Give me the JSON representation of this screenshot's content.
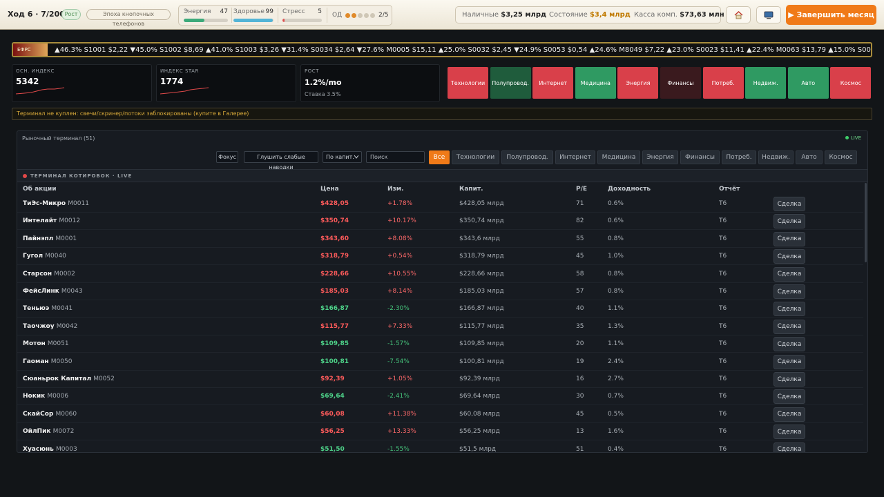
{
  "header": {
    "turn": "Ход 6 · 7/2006",
    "growth_pill": "Рост",
    "era_pill": "Эпоха кнопочных телефонов",
    "energy_label": "Энергия",
    "energy_value": "47",
    "energy_level": 0.47,
    "health_label": "Здоровье",
    "health_value": "99",
    "health_level": 0.99,
    "stress_label": "Стресс",
    "stress_value": "5",
    "stress_level": 0.05,
    "od_label": "ОД",
    "od_value": "2/5",
    "cash_label": "Наличные",
    "cash_value": "$3,25 млрд",
    "wealth_label": "Состояние",
    "wealth_value": "$3,4 млрд",
    "company_cash_label": "Касса комп.",
    "company_cash_value": "$73,63 млн",
    "home_icon": "home-icon",
    "computer_icon": "computer-icon",
    "end_month": "▶ Завершить месяц"
  },
  "ticker": {
    "tag": "ЕФРС",
    "text": "▲46.3%  S1001 $2,22 ▼45.0%  S1002 $8,69 ▲41.0%  S1003 $3,26 ▼31.4%  S0034 $2,64 ▼27.6%  M0005 $15,11 ▲25.0%  S0032 $2,45 ▼24.9%  S0053 $0,54 ▲24.6%  M8049 $7,22 ▲23.0%  S0023 $11,41 ▲22.4%  M0063 $13,79 ▲15.0%  S0033 $1,22 ▼15.0%"
  },
  "cards": {
    "main_index_label": "ОСН. ИНДЕКС",
    "main_index_value": "5342",
    "star_index_label": "ИНДЕКС STAR",
    "star_index_value": "1774",
    "growth_label": "РОСТ",
    "growth_value": "1.2%/mo",
    "rate": "Ставка 3.5%"
  },
  "sectors": [
    {
      "label": "Технологии",
      "color": "#d9404a"
    },
    {
      "label": "Полупровод.",
      "color": "#1f5c3c"
    },
    {
      "label": "Интернет",
      "color": "#d9404a"
    },
    {
      "label": "Медицина",
      "color": "#2f9a62"
    },
    {
      "label": "Энергия",
      "color": "#d9404a"
    },
    {
      "label": "Финансы",
      "color": "#3a1a1e"
    },
    {
      "label": "Потреб.",
      "color": "#d9404a"
    },
    {
      "label": "Недвиж.",
      "color": "#2f9a62"
    },
    {
      "label": "Авто",
      "color": "#2f9a62"
    },
    {
      "label": "Космос",
      "color": "#d9404a"
    }
  ],
  "notice": "Терминал не куплен: свечи/скринер/потоки заблокированы (купите в Галерее)",
  "terminal": {
    "title": "Рыночный терминал (51)",
    "live": "LIVE",
    "focus_button": "Фокус",
    "mute_button": "Глушить слабые наводки",
    "sort_select": "По капит.",
    "search_placeholder": "Поиск",
    "filters": [
      "Все",
      "Технологии",
      "Полупровод.",
      "Интернет",
      "Медицина",
      "Энергия",
      "Финансы",
      "Потреб.",
      "Недвиж.",
      "Авто",
      "Космос"
    ],
    "quotes_title": "ТЕРМИНАЛ КОТИРОВОК · LIVE",
    "columns": [
      "Об акции",
      "Цена",
      "Изм.",
      "Капит.",
      "P/E",
      "Доходность",
      "Отчёт"
    ],
    "deal_label": "Сделка",
    "rows": [
      {
        "name": "ТиЭс-Микро",
        "ticker": "M0011",
        "price": "$428,05",
        "change": "+1.78%",
        "cap": "$428,05 млрд",
        "pe": "71",
        "yield": "0.6%",
        "report": "T6",
        "price_up": true,
        "change_up": true
      },
      {
        "name": "Интелайт",
        "ticker": "M0012",
        "price": "$350,74",
        "change": "+10.17%",
        "cap": "$350,74 млрд",
        "pe": "82",
        "yield": "0.6%",
        "report": "T6",
        "price_up": true,
        "change_up": true
      },
      {
        "name": "Пайнэпл",
        "ticker": "M0001",
        "price": "$343,60",
        "change": "+8.08%",
        "cap": "$343,6 млрд",
        "pe": "55",
        "yield": "0.8%",
        "report": "T6",
        "price_up": true,
        "change_up": true
      },
      {
        "name": "Гугол",
        "ticker": "M0040",
        "price": "$318,79",
        "change": "+0.54%",
        "cap": "$318,79 млрд",
        "pe": "45",
        "yield": "1.0%",
        "report": "T6",
        "price_up": true,
        "change_up": true
      },
      {
        "name": "Старсон",
        "ticker": "M0002",
        "price": "$228,66",
        "change": "+10.55%",
        "cap": "$228,66 млрд",
        "pe": "58",
        "yield": "0.8%",
        "report": "T6",
        "price_up": true,
        "change_up": true
      },
      {
        "name": "ФейсЛинк",
        "ticker": "M0043",
        "price": "$185,03",
        "change": "+8.14%",
        "cap": "$185,03 млрд",
        "pe": "57",
        "yield": "0.8%",
        "report": "T6",
        "price_up": true,
        "change_up": true
      },
      {
        "name": "Теньюэ",
        "ticker": "M0041",
        "price": "$166,87",
        "change": "-2.30%",
        "cap": "$166,87 млрд",
        "pe": "40",
        "yield": "1.1%",
        "report": "T6",
        "price_up": false,
        "change_up": false
      },
      {
        "name": "Таочжоу",
        "ticker": "M0042",
        "price": "$115,77",
        "change": "+7.33%",
        "cap": "$115,77 млрд",
        "pe": "35",
        "yield": "1.3%",
        "report": "T6",
        "price_up": true,
        "change_up": true
      },
      {
        "name": "Мотон",
        "ticker": "M0051",
        "price": "$109,85",
        "change": "-1.57%",
        "cap": "$109,85 млрд",
        "pe": "20",
        "yield": "1.1%",
        "report": "T6",
        "price_up": false,
        "change_up": false
      },
      {
        "name": "Гаоман",
        "ticker": "M0050",
        "price": "$100,81",
        "change": "-7.54%",
        "cap": "$100,81 млрд",
        "pe": "19",
        "yield": "2.4%",
        "report": "T6",
        "price_up": false,
        "change_up": false
      },
      {
        "name": "Сюаньрок Капитал",
        "ticker": "M0052",
        "price": "$92,39",
        "change": "+1.05%",
        "cap": "$92,39 млрд",
        "pe": "16",
        "yield": "2.7%",
        "report": "T6",
        "price_up": true,
        "change_up": true
      },
      {
        "name": "Нокик",
        "ticker": "M0006",
        "price": "$69,64",
        "change": "-2.41%",
        "cap": "$69,64 млрд",
        "pe": "30",
        "yield": "0.7%",
        "report": "T6",
        "price_up": false,
        "change_up": false
      },
      {
        "name": "СкайСор",
        "ticker": "M0060",
        "price": "$60,08",
        "change": "+11.38%",
        "cap": "$60,08 млрд",
        "pe": "45",
        "yield": "0.5%",
        "report": "T6",
        "price_up": true,
        "change_up": true
      },
      {
        "name": "ОйлПик",
        "ticker": "M0072",
        "price": "$56,25",
        "change": "+13.33%",
        "cap": "$56,25 млрд",
        "pe": "13",
        "yield": "1.6%",
        "report": "T6",
        "price_up": true,
        "change_up": true
      },
      {
        "name": "Хуасюнь",
        "ticker": "M0003",
        "price": "$51,50",
        "change": "-1.55%",
        "cap": "$51,5 млрд",
        "pe": "51",
        "yield": "0.4%",
        "report": "T6",
        "price_up": false,
        "change_up": false
      }
    ]
  },
  "colors": {
    "accent": "#f07a18",
    "up": "#ff5b5b",
    "down": "#4ed48a",
    "energy_bar": "#3daa7a",
    "health_bar": "#53b4d6",
    "stress_bar": "#e05050"
  }
}
